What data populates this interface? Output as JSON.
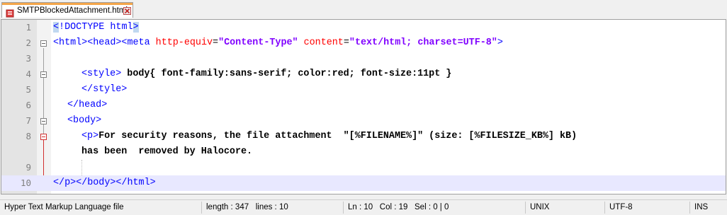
{
  "tab": {
    "filename": "SMTPBlockedAttachment.html",
    "icon": "document-icon",
    "close_icon": "close-icon"
  },
  "editor": {
    "line_numbers": [
      "1",
      "2",
      "3",
      "4",
      "5",
      "6",
      "7",
      "8",
      "9",
      "10"
    ],
    "current_line": 10,
    "colors": {
      "tag": "#0000ff",
      "attribute": "#ff0000",
      "value": "#8000ff",
      "current_line_bg": "#e8e8ff"
    },
    "lines": {
      "l1": {
        "lt": "<",
        "rest": "!DOCTYPE html",
        "gt": ">"
      },
      "l2": {
        "tags": "<html><head><meta ",
        "attr1": "http-equiv",
        "eq1": "=",
        "val1": "\"Content-Type\"",
        "attr2": " content",
        "eq2": "=",
        "val2": "\"text/html; charset=UTF-8\"",
        "close": ">"
      },
      "l4": {
        "open": "<style>",
        "text": " body{ font-family:sans-serif; color:red; font-size:11pt }"
      },
      "l5": {
        "tag": "</style>"
      },
      "l6": {
        "tag": "</head>"
      },
      "l7": {
        "tag": "<body>"
      },
      "l8": {
        "tag": "<p>",
        "text": "For security reasons, the file attachment  \"[%FILENAME%]\" (size: [%FILESIZE_KB%] kB)"
      },
      "l8b": {
        "text": "has been  removed by Halocore."
      },
      "l10": {
        "tags": "</p></body></html>"
      }
    }
  },
  "statusbar": {
    "file_type": "Hyper Text Markup Language file",
    "length": "length : 347",
    "lines": "lines : 10",
    "ln": "Ln : 10",
    "col": "Col : 19",
    "sel": "Sel : 0 | 0",
    "eol": "UNIX",
    "encoding": "UTF-8",
    "mode": "INS"
  }
}
